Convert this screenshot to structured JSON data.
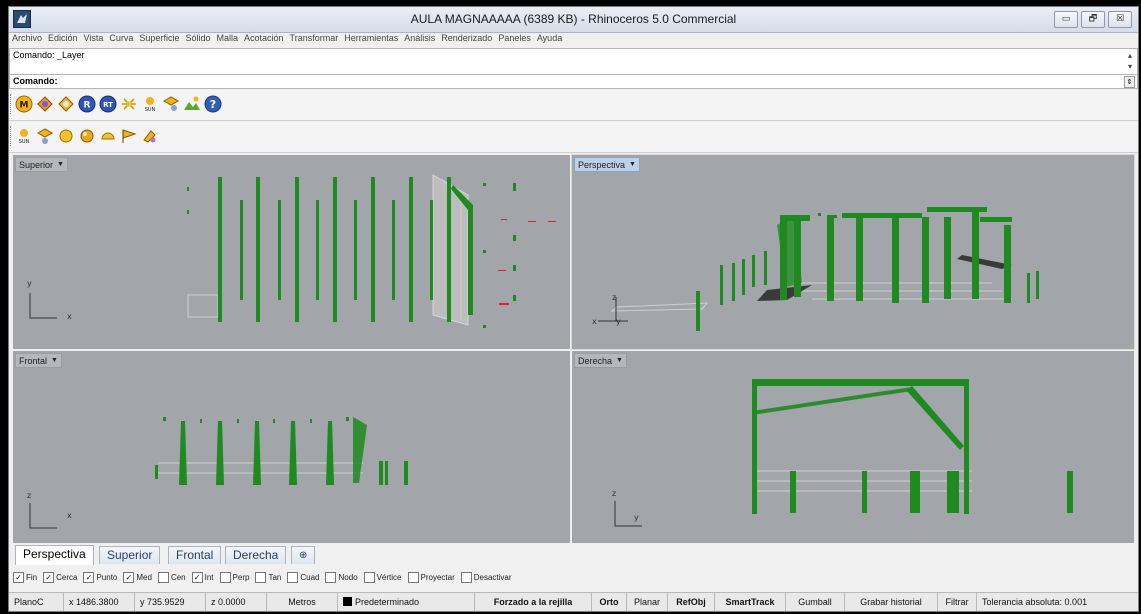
{
  "window": {
    "title": "AULA MAGNAAAAA (6389 KB) - Rhinoceros 5.0 Commercial",
    "controls": {
      "minimize": "▭",
      "maximize": "🗗",
      "close": "☒"
    }
  },
  "menu": [
    "Archivo",
    "Edición",
    "Vista",
    "Curva",
    "Superficie",
    "Sólido",
    "Malla",
    "Acotación",
    "Transformar",
    "Herramientas",
    "Análisis",
    "Renderizado",
    "Paneles",
    "Ayuda"
  ],
  "command": {
    "history": "Comando: _Layer",
    "prompt": "Comando:"
  },
  "toolbars": {
    "row1": [
      "maxwell-icon",
      "material-tag-icon",
      "material-tag-orange-icon",
      "render-r-icon",
      "render-rt-icon",
      "light-ies-icon",
      "sun-icon",
      "emitter-icon",
      "environment-icon",
      "help-icon"
    ],
    "row2": [
      "sun-small-icon",
      "emitter-small-icon",
      "sphere-yellow-icon",
      "sphere-orange-icon",
      "hemisphere-icon",
      "flag-icon",
      "material-picker-icon"
    ],
    "row1_labels": {
      "m": "M",
      "r": "R",
      "rt": "RT",
      "sun": "SUN",
      "help": "?"
    },
    "row2_labels": {
      "sun": "SUN"
    }
  },
  "viewports": {
    "superior": {
      "label": "Superior",
      "axis_y": "y",
      "axis_x": "x"
    },
    "perspectiva": {
      "label": "Perspectiva",
      "axis_z": "z",
      "axis_x": "x",
      "axis_y": "y"
    },
    "frontal": {
      "label": "Frontal",
      "axis_z": "z",
      "axis_x": "x"
    },
    "derecha": {
      "label": "Derecha",
      "axis_z": "z",
      "axis_y": "y"
    }
  },
  "tabs": [
    "Perspectiva",
    "Superior",
    "Frontal",
    "Derecha"
  ],
  "tab_add": "⊕",
  "osnap": [
    {
      "label": "Fin",
      "checked": true
    },
    {
      "label": "Cerca",
      "checked": true
    },
    {
      "label": "Punto",
      "checked": true
    },
    {
      "label": "Med",
      "checked": true
    },
    {
      "label": "Cen",
      "checked": false
    },
    {
      "label": "Int",
      "checked": true
    },
    {
      "label": "Perp",
      "checked": false
    },
    {
      "label": "Tan",
      "checked": false
    },
    {
      "label": "Cuad",
      "checked": false
    },
    {
      "label": "Nodo",
      "checked": false
    },
    {
      "label": "Vértice",
      "checked": false
    },
    {
      "label": "Proyectar",
      "checked": false
    },
    {
      "label": "Desactivar",
      "checked": false
    }
  ],
  "status": {
    "plane": "PlanoC",
    "x": "x 1486.3800",
    "y": "y 735.9529",
    "z": "z 0.0000",
    "units": "Metros",
    "layer": "Predeterminado",
    "grid_snap": "Forzado a la rejilla",
    "ortho": "Orto",
    "planar": "Planar",
    "osnap": "RefObj",
    "smarttrack": "SmartTrack",
    "gumball": "Gumball",
    "history": "Grabar historial",
    "filter": "Filtrar",
    "tolerance": "Tolerancia absoluta: 0.001"
  },
  "colors": {
    "viewport_bg": "#a2a5a9",
    "geometry_green": "#1f8a1f",
    "geometry_gray": "#cfcfcf",
    "active_label": "#bcd0ea",
    "accent_red": "#d22"
  }
}
